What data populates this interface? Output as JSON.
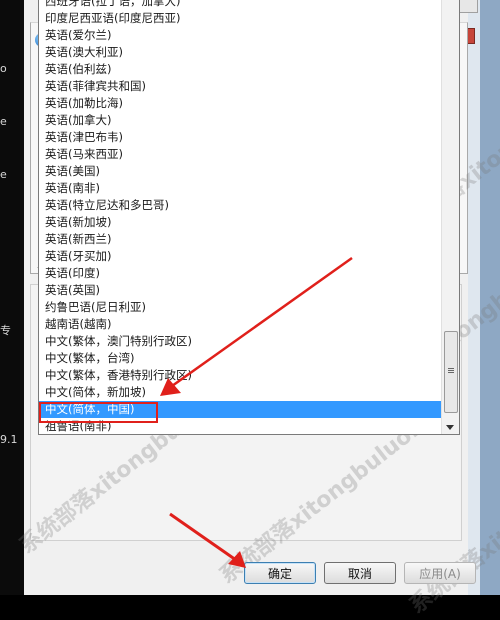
{
  "desktop": {
    "left_glyphs": [
      "o",
      "e",
      "e",
      "专",
      "9.1"
    ]
  },
  "dropdown": {
    "items": [
      "西班牙语(拉丁语，加拿大)",
      "印度尼西亚语(印度尼西亚)",
      "英语(爱尔兰)",
      "英语(澳大利亚)",
      "英语(伯利兹)",
      "英语(菲律宾共和国)",
      "英语(加勒比海)",
      "英语(加拿大)",
      "英语(津巴布韦)",
      "英语(马来西亚)",
      "英语(美国)",
      "英语(南非)",
      "英语(特立尼达和多巴哥)",
      "英语(新加坡)",
      "英语(新西兰)",
      "英语(牙买加)",
      "英语(印度)",
      "英语(英国)",
      "约鲁巴语(尼日利亚)",
      "越南语(越南)",
      "中文(繁体，澳门特别行政区)",
      "中文(繁体，台湾)",
      "中文(繁体，香港特别行政区)",
      "中文(简体，新加坡)",
      "中文(简体，中国)",
      "祖鲁语(南非)"
    ],
    "selected_index": 24
  },
  "buttons": {
    "ok": "确定",
    "cancel": "取消",
    "apply": "应用(A)"
  },
  "watermark": "系统部落xitongbuluo.com",
  "colors": {
    "selection": "#3399ff",
    "annotation": "#e0201b"
  }
}
